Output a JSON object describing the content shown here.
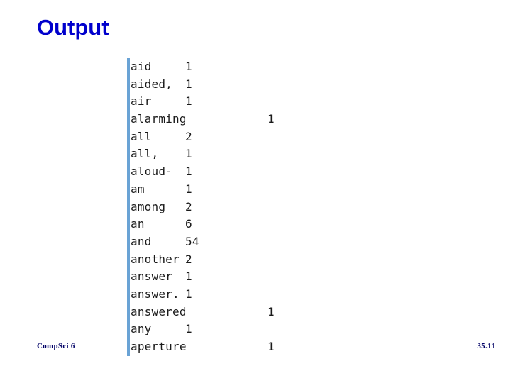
{
  "slide": {
    "title": "Output",
    "title_color": "#0000CC",
    "background_color": "#FFFFFF"
  },
  "output_panel": {
    "accent_bar_color": "#6AA3D5",
    "text_color": "#1A1A1A",
    "rows": [
      {
        "word": "aid",
        "count": "1",
        "tab_stop": 1
      },
      {
        "word": "aided,",
        "count": "1",
        "tab_stop": 1
      },
      {
        "word": "air",
        "count": "1",
        "tab_stop": 1
      },
      {
        "word": "alarming",
        "count": "1",
        "tab_stop": 2
      },
      {
        "word": "all",
        "count": "2",
        "tab_stop": 1
      },
      {
        "word": "all,",
        "count": "1",
        "tab_stop": 1
      },
      {
        "word": "aloud-",
        "count": "1",
        "tab_stop": 1
      },
      {
        "word": "am",
        "count": "1",
        "tab_stop": 1
      },
      {
        "word": "among",
        "count": "2",
        "tab_stop": 1
      },
      {
        "word": "an",
        "count": "6",
        "tab_stop": 1
      },
      {
        "word": "and",
        "count": "54",
        "tab_stop": 1
      },
      {
        "word": "another",
        "count": "2",
        "tab_stop": 1
      },
      {
        "word": "answer",
        "count": "1",
        "tab_stop": 1
      },
      {
        "word": "answer.",
        "count": "1",
        "tab_stop": 1
      },
      {
        "word": "answered",
        "count": "1",
        "tab_stop": 2
      },
      {
        "word": "any",
        "count": "1",
        "tab_stop": 1
      },
      {
        "word": "aperture",
        "count": "1",
        "tab_stop": 2
      }
    ]
  },
  "footer": {
    "course": "CompSci 6",
    "page_number": "35.11",
    "text_color": "#000066"
  }
}
